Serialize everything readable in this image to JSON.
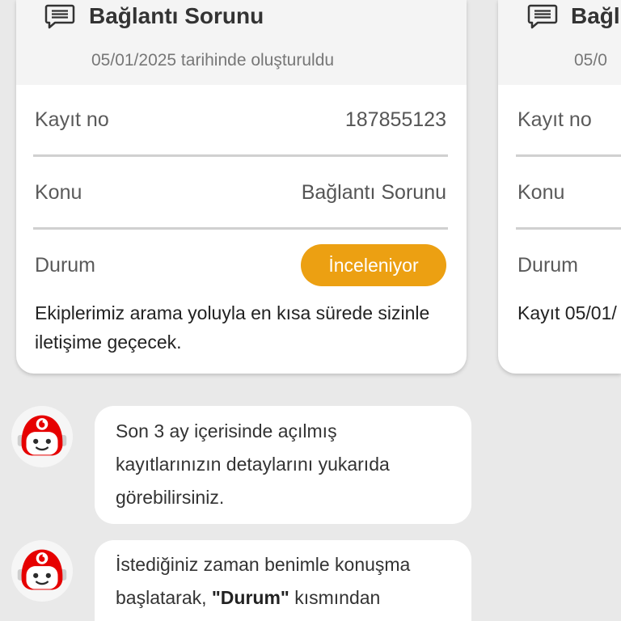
{
  "cards": [
    {
      "title": "Bağlantı Sorunu",
      "created": "05/01/2025 tarihinde oluşturuldu",
      "rows": [
        {
          "label": "Kayıt no",
          "value": "187855123"
        },
        {
          "label": "Konu",
          "value": "Bağlantı Sorunu"
        },
        {
          "label": "Durum",
          "value": "İnceleniyor"
        }
      ],
      "note_lines": [
        "Ekiplerimiz arama yoluyla en kısa sürede sizinle",
        "iletişime geçecek."
      ]
    },
    {
      "title": "Bağl",
      "created": "05/0",
      "rows": [
        {
          "label": "Kayıt no"
        },
        {
          "label": "Konu"
        },
        {
          "label": "Durum"
        }
      ],
      "note_lines": [
        "Kayıt 05/01/"
      ]
    }
  ],
  "messages": [
    {
      "lines": [
        "Son 3 ay içerisinde açılmış",
        "kayıtlarınızın detaylarını yukarıda",
        "görebilirsiniz."
      ]
    },
    {
      "lines": [
        "İstediğiniz zaman benimle konuşma"
      ],
      "rich_line": [
        {
          "text": "başlatarak, ",
          "bold": false
        },
        {
          "text": "\"Durum\"",
          "bold": true
        },
        {
          "text": " kısmından",
          "bold": false
        }
      ]
    }
  ],
  "icons": {
    "card_header": "chat-bubble-icon",
    "avatar": "tobi-avatar-icon"
  },
  "colors": {
    "page_background": "#e9e9e9",
    "card_header_background": "#f4f4f4",
    "status_badge": "#eca012",
    "brand_red": "#e60000"
  }
}
